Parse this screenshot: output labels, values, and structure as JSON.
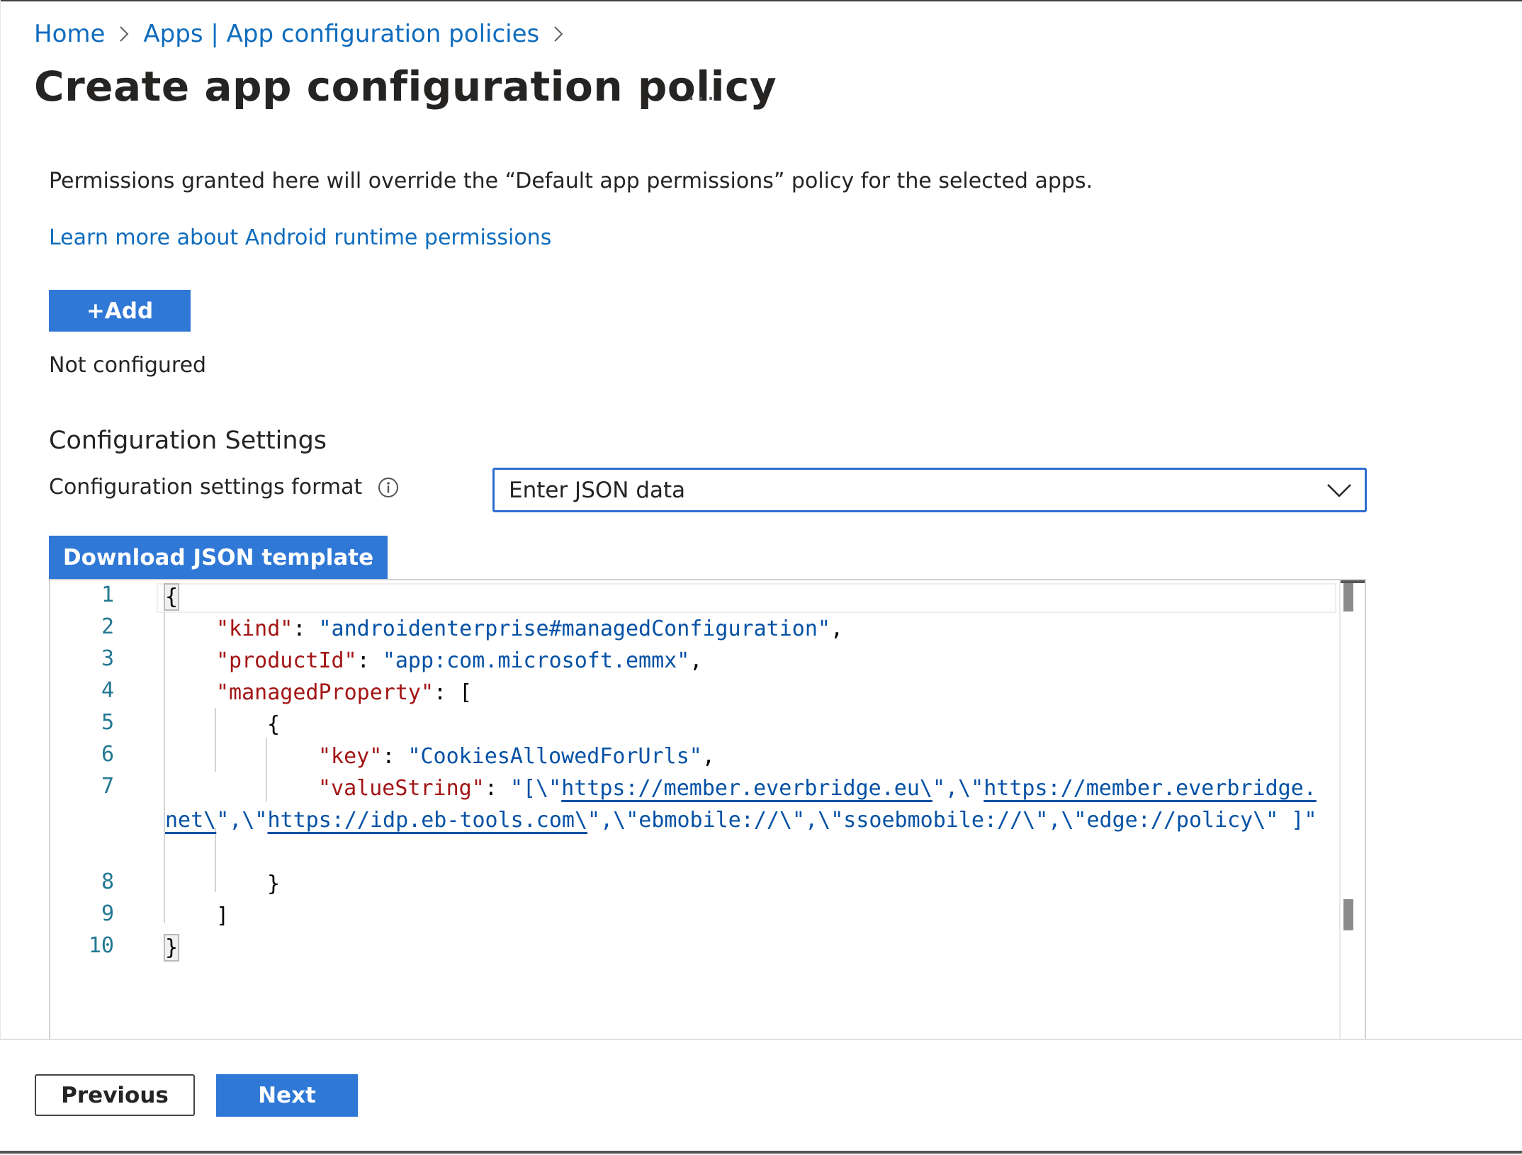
{
  "breadcrumb": {
    "items": [
      "Home",
      "Apps | App configuration policies"
    ]
  },
  "header": {
    "title": "Create app configuration policy",
    "more_label": "..."
  },
  "permissions": {
    "description": "Permissions granted here will override the “Default app permissions” policy for the selected apps.",
    "learn_more": "Learn more about Android runtime permissions",
    "add_label": "+Add",
    "status": "Not configured"
  },
  "config": {
    "section_title": "Configuration Settings",
    "format_label": "Configuration settings format",
    "format_value": "Enter JSON data",
    "download_label": "Download JSON template"
  },
  "editor": {
    "line_numbers": [
      "1",
      "2",
      "3",
      "4",
      "5",
      "6",
      "7",
      "8",
      "9",
      "10"
    ],
    "tokens": {
      "open_brace": "{",
      "kind_key": "\"kind\"",
      "kind_value": "\"androidenterprise#managedConfiguration\"",
      "product_key": "\"productId\"",
      "product_value": "\"app:com.microsoft.emmx\"",
      "managed_key": "\"managedProperty\"",
      "array_open": "[",
      "item_open": "{",
      "key_key": "\"key\"",
      "key_value": "\"CookiesAllowedForUrls\"",
      "value_key": "\"valueString\"",
      "value_part1": "\"[\\\"",
      "url1": "https://member.everbridge.eu\\",
      "value_part2": "\",\\\"",
      "url2": "https://member.everbridge.",
      "url2_cont": "net\\",
      "value_part3": "\",\\\"",
      "url3": "https://idp.eb-tools.com\\",
      "value_part4": "\",\\\"ebmobile://\\\",\\\"ssoebmobile://\\\",\\\"edge://policy\\\" ]\"",
      "item_close": "}",
      "array_close": "]",
      "close_brace": "}",
      "colon": ": ",
      "comma": ","
    }
  },
  "footer": {
    "previous_label": "Previous",
    "next_label": "Next"
  },
  "colors": {
    "accent": "#2f78d6",
    "link": "#0f6cbd",
    "json_key": "#a31515",
    "json_string": "#0451a5",
    "line_number": "#237893"
  }
}
